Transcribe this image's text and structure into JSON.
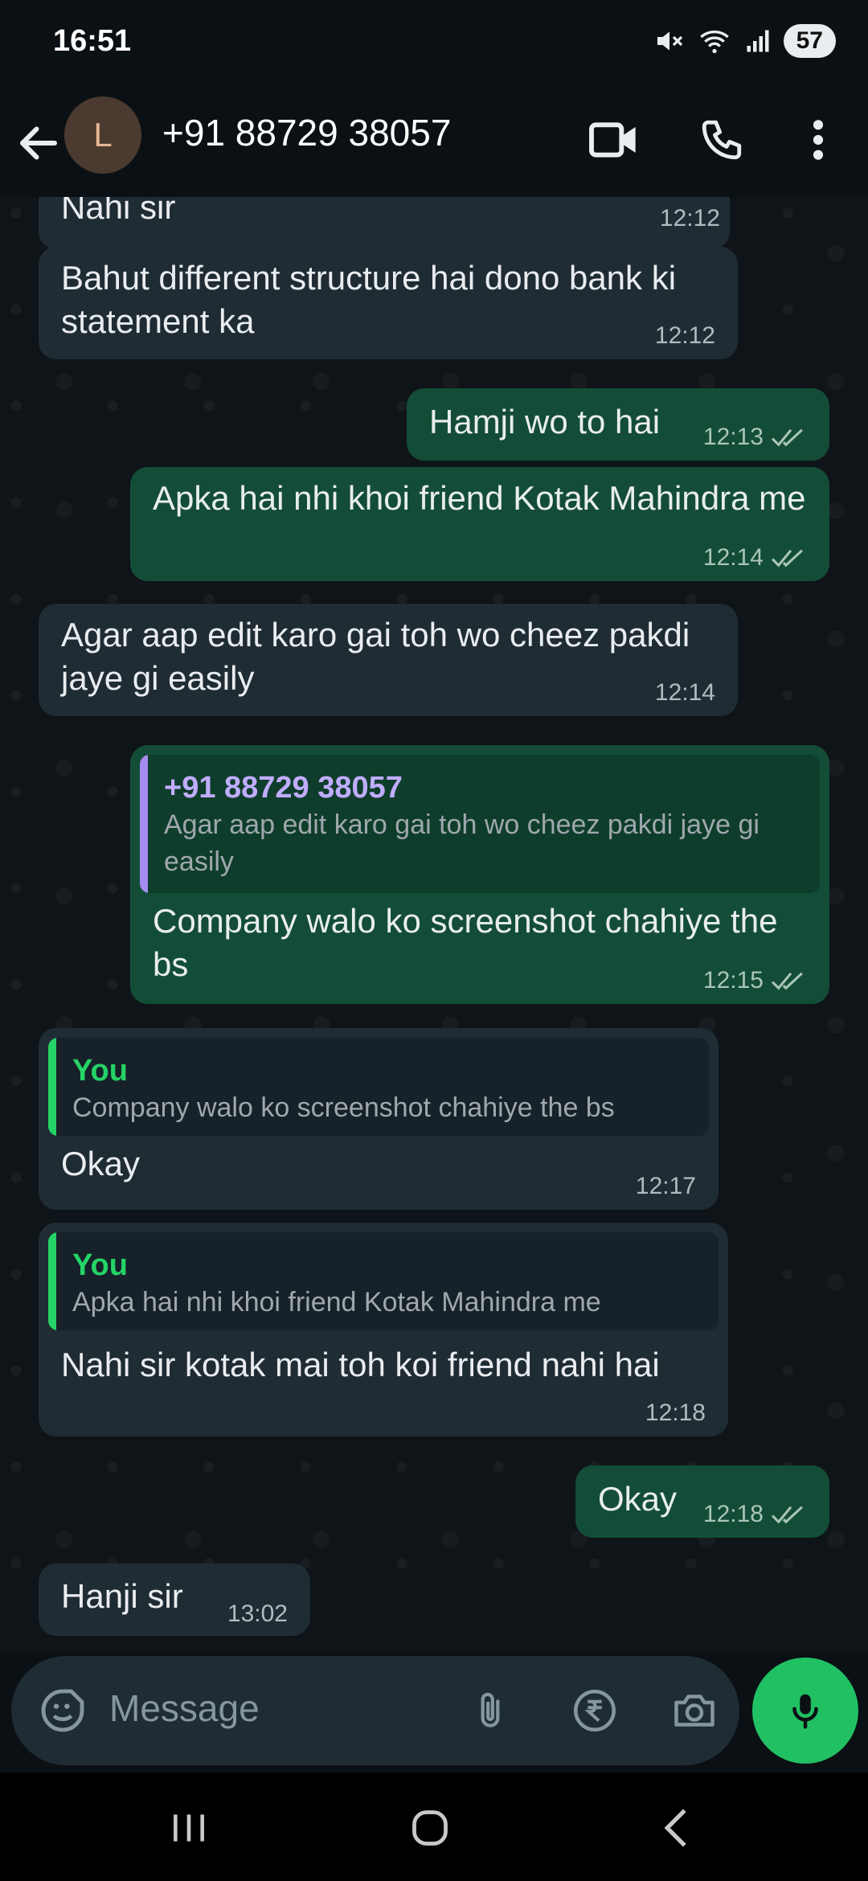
{
  "status_bar": {
    "time": "16:51",
    "battery": "57"
  },
  "header": {
    "avatar_letter": "L",
    "contact_name": "+91 88729 38057"
  },
  "messages": [
    {
      "text": "Nahi sir",
      "time": "12:12"
    },
    {
      "text": "Bahut different structure hai dono bank ki statement ka",
      "time": "12:12"
    },
    {
      "text": "Hamji wo to hai",
      "time": "12:13"
    },
    {
      "text": "Apka hai nhi khoi friend Kotak Mahindra me",
      "time": "12:14"
    },
    {
      "text": "Agar aap edit karo gai toh wo cheez pakdi jaye gi easily",
      "time": "12:14"
    },
    {
      "quote_author": "+91 88729 38057",
      "quote_text": "Agar aap edit karo gai toh wo cheez pakdi jaye gi easily",
      "text": "Company walo ko screenshot chahiye the bs",
      "time": "12:15"
    },
    {
      "quote_author": "You",
      "quote_text": "Company walo ko screenshot chahiye the bs",
      "text": "Okay",
      "time": "12:17"
    },
    {
      "quote_author": "You",
      "quote_text": "Apka hai nhi khoi friend Kotak Mahindra me",
      "text": "Nahi sir kotak mai toh koi friend nahi hai",
      "time": "12:18"
    },
    {
      "text": "Okay",
      "time": "12:18"
    },
    {
      "text": "Hanji sir",
      "time": "13:02"
    }
  ],
  "composer": {
    "placeholder": "Message"
  },
  "colors": {
    "incoming": "#1f2c34",
    "outgoing": "#144d37",
    "accent": "#21c063"
  }
}
